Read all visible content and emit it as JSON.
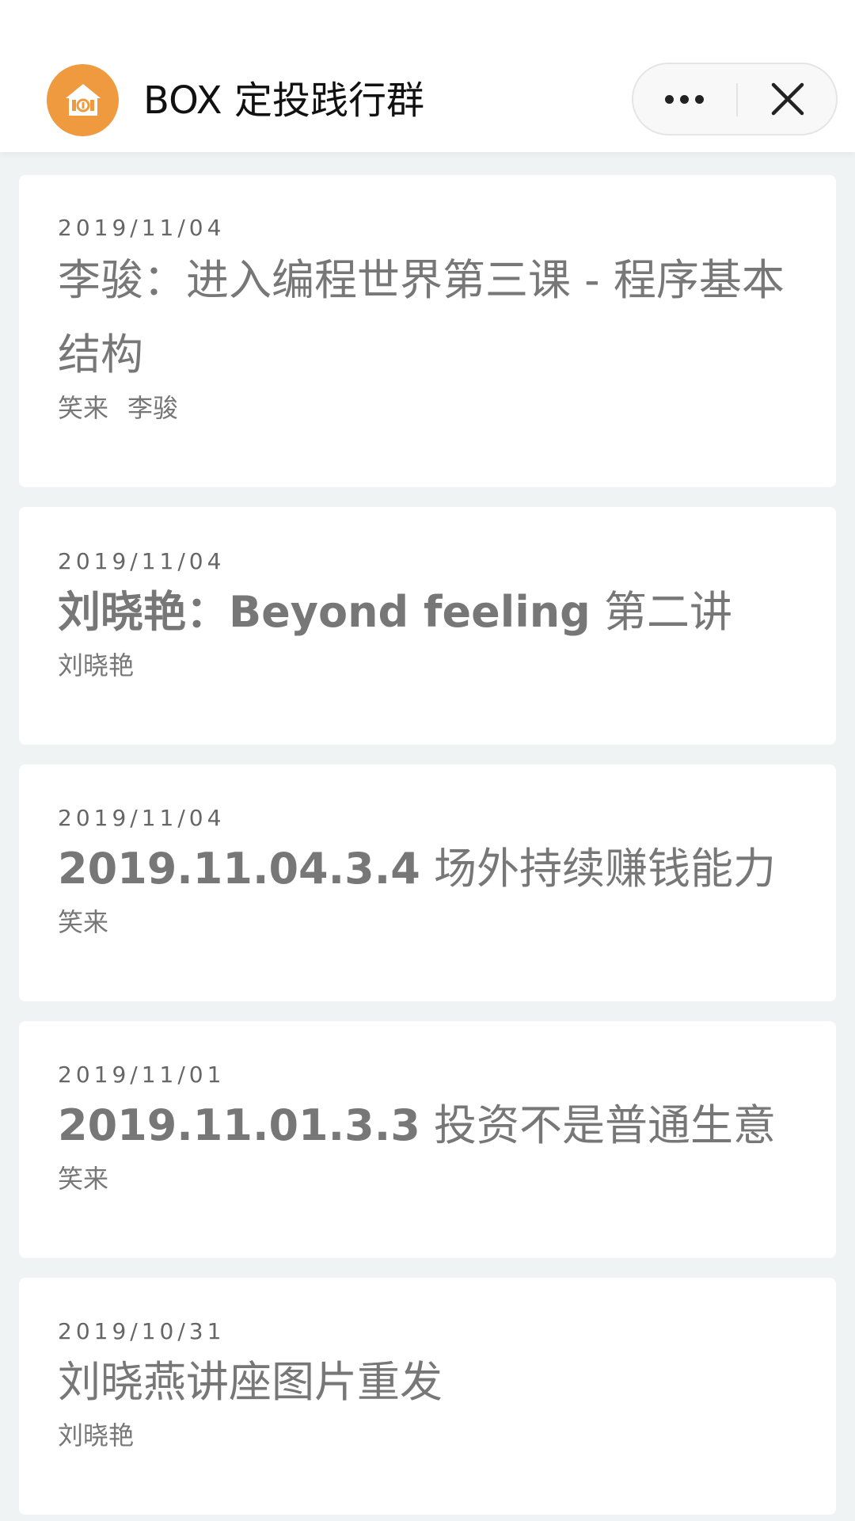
{
  "header": {
    "title": "BOX 定投践行群",
    "logo_icon": "home-coin-icon",
    "more_icon": "more-dots-icon",
    "close_icon": "close-icon"
  },
  "colors": {
    "status_pill": "#49c11b",
    "logo_bg": "#ef9a3f",
    "card_bg": "#ffffff",
    "page_bg": "#eff3f4",
    "text_muted": "#777777"
  },
  "articles": [
    {
      "date": "2019/11/04",
      "title_bold": "",
      "title": "李骏：进入编程世界第三课 - 程序基本结构",
      "authors": [
        "笑来",
        "李骏"
      ]
    },
    {
      "date": "2019/11/04",
      "title_bold": "刘晓艳：Beyond feeling",
      "title": " 第二讲",
      "authors": [
        "刘晓艳"
      ]
    },
    {
      "date": "2019/11/04",
      "title_bold": "2019.11.04.3.4",
      "title": " 场外持续赚钱能力",
      "authors": [
        "笑来"
      ]
    },
    {
      "date": "2019/11/01",
      "title_bold": "2019.11.01.3.3",
      "title": " 投资不是普通生意",
      "authors": [
        "笑来"
      ]
    },
    {
      "date": "2019/10/31",
      "title_bold": "",
      "title": "刘晓燕讲座图片重发",
      "authors": [
        "刘晓艳"
      ]
    }
  ]
}
